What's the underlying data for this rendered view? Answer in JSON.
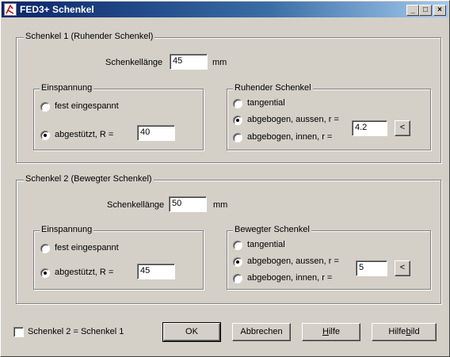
{
  "window": {
    "title": "FED3+ Schenkel",
    "min_symbol": "_",
    "max_symbol": "□",
    "close_symbol": "×"
  },
  "schenkel1": {
    "title": "Schenkel 1 (Ruhender Schenkel)",
    "laenge_label": "Schenkellänge",
    "laenge_value": "45",
    "unit": "mm",
    "einspannung": {
      "title": "Einspannung",
      "option_fest": "fest eingespannt",
      "option_abgestuetzt": "abgestützt, R =",
      "r_value": "40"
    },
    "schenkel": {
      "title": "Ruhender Schenkel",
      "option_tangential": "tangential",
      "option_aussen": "abgebogen, aussen, r =",
      "option_innen": "abgebogen, innen, r =",
      "r_value": "4.2",
      "btn_label": "<"
    }
  },
  "schenkel2": {
    "title": "Schenkel 2 (Bewegter Schenkel)",
    "laenge_label": "Schenkellänge",
    "laenge_value": "50",
    "unit": "mm",
    "einspannung": {
      "title": "Einspannung",
      "option_fest": "fest eingespannt",
      "option_abgestuetzt": "abgestützt, R =",
      "r_value": "45"
    },
    "schenkel": {
      "title": "Bewegter Schenkel",
      "option_tangential": "tangential",
      "option_aussen": "abgebogen, aussen, r =",
      "option_innen": "abgebogen, innen, r =",
      "r_value": "5",
      "btn_label": "<"
    }
  },
  "footer": {
    "checkbox_label": "Schenkel 2 = Schenkel 1",
    "ok": "OK",
    "abbrechen": "Abbrechen",
    "hilfe_h": "H",
    "hilfe_rest": "ilfe",
    "hilfebild_pre": "Hilfe",
    "hilfebild_b": "b",
    "hilfebild_post": "ild"
  }
}
